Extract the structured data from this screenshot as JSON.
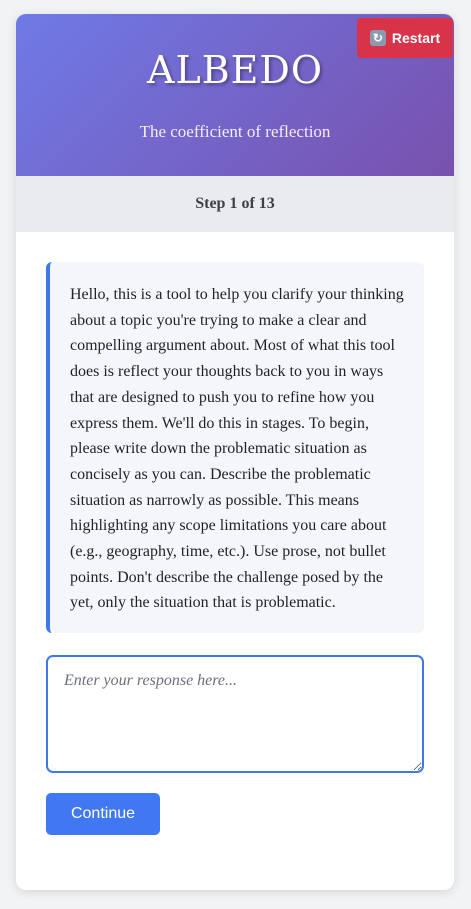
{
  "header": {
    "title": "ALBEDO",
    "subtitle": "The coefficient of reflection",
    "restart_label": "Restart",
    "restart_icon": "refresh-icon"
  },
  "progress": {
    "step_label": "Step 1 of 13",
    "current_step": 1,
    "total_steps": 13
  },
  "prompt": {
    "text": "Hello, this is a tool to help you clarify your thinking about a topic you're trying to make a clear and compelling argument about. Most of what this tool does is reflect your thoughts back to you in ways that are designed to push you to refine how you express them. We'll do this in stages. To begin, please write down the problematic situation as concisely as you can. Describe the problematic situation as narrowly as possible. This means highlighting any scope limitations you care about (e.g., geography, time, etc.). Use prose, not bullet points. Don't describe the challenge posed by the yet, only the situation that is problematic."
  },
  "response": {
    "value": "",
    "placeholder": "Enter your response here..."
  },
  "actions": {
    "continue_label": "Continue"
  },
  "colors": {
    "header_gradient_start": "#6f7ae6",
    "header_gradient_end": "#7851ad",
    "restart_button": "#d9334a",
    "accent_blue": "#3f78f2"
  }
}
